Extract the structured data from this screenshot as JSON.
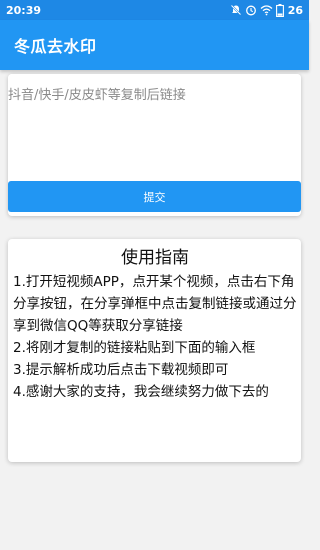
{
  "status_bar": {
    "time": "20:39",
    "battery": "26",
    "icons": [
      "mute-icon",
      "alarm-icon",
      "wifi-icon",
      "battery-icon"
    ]
  },
  "app_bar": {
    "title": "冬瓜去水印"
  },
  "input_card": {
    "placeholder": "抖音/快手/皮皮虾等复制后链接",
    "value": "",
    "submit_label": "提交"
  },
  "guide": {
    "title": "使用指南",
    "items": [
      "1.打开短视频APP，点开某个视频，点击右下角分享按钮，在分享弹框中点击复制链接或通过分享到微信QQ等获取分享链接",
      "2.将刚才复制的链接粘贴到下面的输入框",
      "3.提示解析成功后点击下载视频即可",
      "4.感谢大家的支持，我会继续努力做下去的"
    ]
  },
  "colors": {
    "primary": "#2196f3",
    "status_bar": "#1e88e5",
    "background": "#f2f2f2"
  }
}
